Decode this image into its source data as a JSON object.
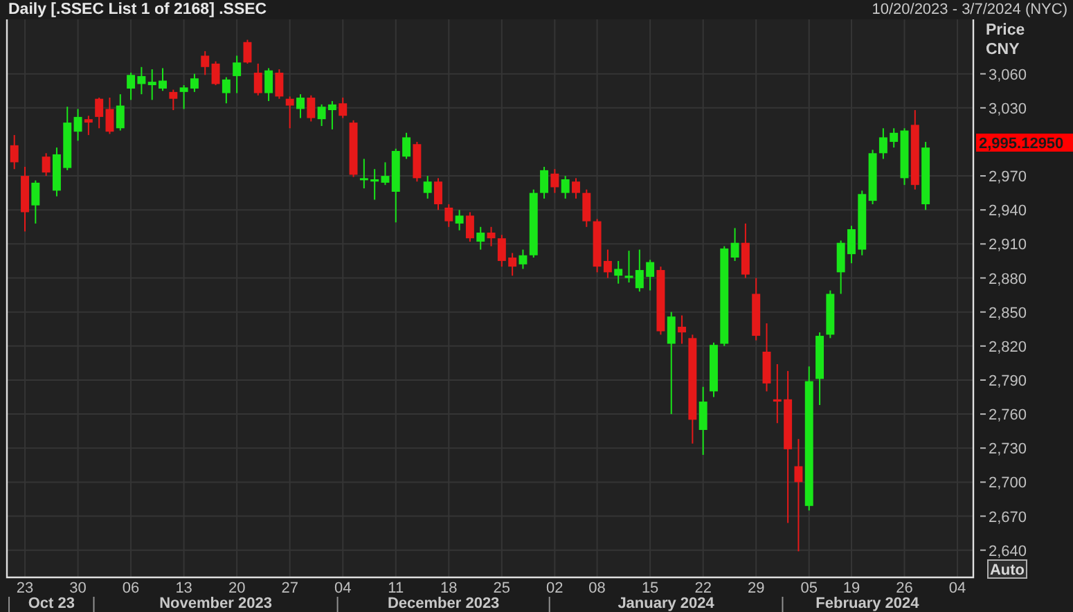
{
  "header": {
    "title": "Daily [.SSEC List 1 of 2168] .SSEC",
    "date_range": "10/20/2023 - 3/7/2024 (NYC)"
  },
  "chart": {
    "chart_data": {
      "type": "candlestick",
      "ylabel": "Price CNY",
      "ylim": [
        2616,
        3108
      ],
      "grid": true,
      "yticks": [
        {
          "value": 3060,
          "label": "3,060"
        },
        {
          "value": 3030,
          "label": "3,030"
        },
        {
          "value": 2970,
          "label": "2,970"
        },
        {
          "value": 2940,
          "label": "2,940"
        },
        {
          "value": 2910,
          "label": "2,910"
        },
        {
          "value": 2880,
          "label": "2,880"
        },
        {
          "value": 2850,
          "label": "2,850"
        },
        {
          "value": 2820,
          "label": "2,820"
        },
        {
          "value": 2790,
          "label": "2,790"
        },
        {
          "value": 2760,
          "label": "2,760"
        },
        {
          "value": 2730,
          "label": "2,730"
        },
        {
          "value": 2700,
          "label": "2,700"
        },
        {
          "value": 2670,
          "label": "2,670"
        },
        {
          "value": 2640,
          "label": "2,640"
        }
      ],
      "categories": [
        null,
        "23",
        null,
        null,
        null,
        null,
        "30",
        null,
        null,
        null,
        null,
        "06",
        null,
        null,
        null,
        null,
        "13",
        null,
        null,
        null,
        null,
        "20",
        null,
        null,
        null,
        null,
        "27",
        null,
        null,
        null,
        null,
        "04",
        null,
        null,
        null,
        null,
        "11",
        null,
        null,
        null,
        null,
        "18",
        null,
        null,
        null,
        null,
        "25",
        null,
        null,
        null,
        null,
        "02",
        null,
        null,
        null,
        "08",
        null,
        null,
        null,
        null,
        "15",
        null,
        null,
        null,
        null,
        "22",
        null,
        null,
        null,
        null,
        "29",
        null,
        null,
        null,
        null,
        "05",
        null,
        null,
        null,
        "19",
        null,
        null,
        null,
        null,
        "26",
        null,
        null,
        null,
        null,
        "04"
      ],
      "ohlc": [
        [
          2997,
          3006,
          2976,
          2982
        ],
        [
          2970,
          2978,
          2921,
          2938
        ],
        [
          2944,
          2966,
          2928,
          2964
        ],
        [
          2987,
          2990,
          2970,
          2973
        ],
        [
          2957,
          2995,
          2952,
          2989
        ],
        [
          2977,
          3031,
          2975,
          3017
        ],
        [
          3009,
          3029,
          3001,
          3022
        ],
        [
          3020,
          3023,
          3006,
          3017
        ],
        [
          3038,
          3039,
          3012,
          3022
        ],
        [
          3029,
          3039,
          3007,
          3009
        ],
        [
          3012,
          3042,
          3010,
          3032
        ],
        [
          3047,
          3061,
          3037,
          3059
        ],
        [
          3051,
          3066,
          3042,
          3058
        ],
        [
          3050,
          3064,
          3037,
          3053
        ],
        [
          3047,
          3065,
          3045,
          3054
        ],
        [
          3044,
          3046,
          3028,
          3038
        ],
        [
          3044,
          3050,
          3029,
          3048
        ],
        [
          3047,
          3060,
          3044,
          3056
        ],
        [
          3076,
          3080,
          3059,
          3066
        ],
        [
          3069,
          3071,
          3050,
          3051
        ],
        [
          3043,
          3057,
          3034,
          3055
        ],
        [
          3058,
          3076,
          3043,
          3070
        ],
        [
          3088,
          3090,
          3069,
          3070
        ],
        [
          3061,
          3069,
          3041,
          3043
        ],
        [
          3043,
          3065,
          3036,
          3063
        ],
        [
          3061,
          3064,
          3038,
          3040
        ],
        [
          3038,
          3040,
          3012,
          3032
        ],
        [
          3029,
          3042,
          3021,
          3039
        ],
        [
          3039,
          3041,
          3018,
          3021
        ],
        [
          3020,
          3033,
          3014,
          3031
        ],
        [
          3028,
          3036,
          3011,
          3033
        ],
        [
          3034,
          3039,
          3021,
          3023
        ],
        [
          3017,
          3019,
          2969,
          2971
        ],
        [
          2967,
          2985,
          2959,
          2968
        ],
        [
          2965,
          2976,
          2949,
          2967
        ],
        [
          2964,
          2982,
          2962,
          2970
        ],
        [
          2956,
          2994,
          2929,
          2992
        ],
        [
          2987,
          3008,
          2985,
          3004
        ],
        [
          2998,
          3000,
          2965,
          2968
        ],
        [
          2955,
          2970,
          2950,
          2965
        ],
        [
          2965,
          2968,
          2940,
          2945
        ],
        [
          2942,
          2945,
          2925,
          2930
        ],
        [
          2928,
          2940,
          2922,
          2935
        ],
        [
          2935,
          2938,
          2912,
          2915
        ],
        [
          2912,
          2925,
          2905,
          2920
        ],
        [
          2920,
          2925,
          2908,
          2915
        ],
        [
          2915,
          2918,
          2890,
          2895
        ],
        [
          2898,
          2902,
          2882,
          2890
        ],
        [
          2892,
          2905,
          2888,
          2900
        ],
        [
          2900,
          2958,
          2898,
          2955
        ],
        [
          2955,
          2978,
          2950,
          2975
        ],
        [
          2972,
          2976,
          2955,
          2960
        ],
        [
          2955,
          2970,
          2950,
          2967
        ],
        [
          2965,
          2968,
          2950,
          2955
        ],
        [
          2955,
          2958,
          2925,
          2930
        ],
        [
          2930,
          2932,
          2885,
          2890
        ],
        [
          2895,
          2905,
          2880,
          2885
        ],
        [
          2882,
          2895,
          2875,
          2888
        ],
        [
          2880,
          2904,
          2876,
          2882
        ],
        [
          2871,
          2905,
          2868,
          2887
        ],
        [
          2881,
          2896,
          2869,
          2894
        ],
        [
          2887,
          2890,
          2830,
          2833
        ],
        [
          2822,
          2850,
          2760,
          2846
        ],
        [
          2837,
          2847,
          2822,
          2832
        ],
        [
          2827,
          2830,
          2734,
          2755
        ],
        [
          2746,
          2784,
          2724,
          2771
        ],
        [
          2780,
          2823,
          2775,
          2821
        ],
        [
          2822,
          2908,
          2820,
          2906
        ],
        [
          2898,
          2924,
          2895,
          2911
        ],
        [
          2911,
          2928,
          2880,
          2883
        ],
        [
          2866,
          2880,
          2825,
          2829
        ],
        [
          2815,
          2840,
          2780,
          2787
        ],
        [
          2773,
          2804,
          2752,
          2771
        ],
        [
          2773,
          2798,
          2664,
          2729
        ],
        [
          2714,
          2738,
          2639,
          2700
        ],
        [
          2679,
          2802,
          2675,
          2789
        ],
        [
          2791,
          2832,
          2768,
          2829
        ],
        [
          2830,
          2869,
          2827,
          2866
        ],
        [
          2885,
          2913,
          2866,
          2911
        ],
        [
          2901,
          2926,
          2893,
          2923
        ],
        [
          2905,
          2957,
          2900,
          2954
        ],
        [
          2948,
          2993,
          2945,
          2990
        ],
        [
          2990,
          3012,
          2985,
          3004
        ],
        [
          3000,
          3012,
          2995,
          3008
        ],
        [
          2968,
          3012,
          2962,
          3010
        ],
        [
          3015,
          3028,
          2958,
          2962
        ],
        [
          2945,
          3000,
          2940,
          2995
        ],
        null,
        null,
        null
      ]
    }
  },
  "month_labels": [
    "Oct 23",
    "November 2023",
    "December 2023",
    "January 2024",
    "February 2024"
  ],
  "last_price_tag": {
    "label": "2,995.12950"
  },
  "auto_button": {
    "label": "Auto"
  }
}
